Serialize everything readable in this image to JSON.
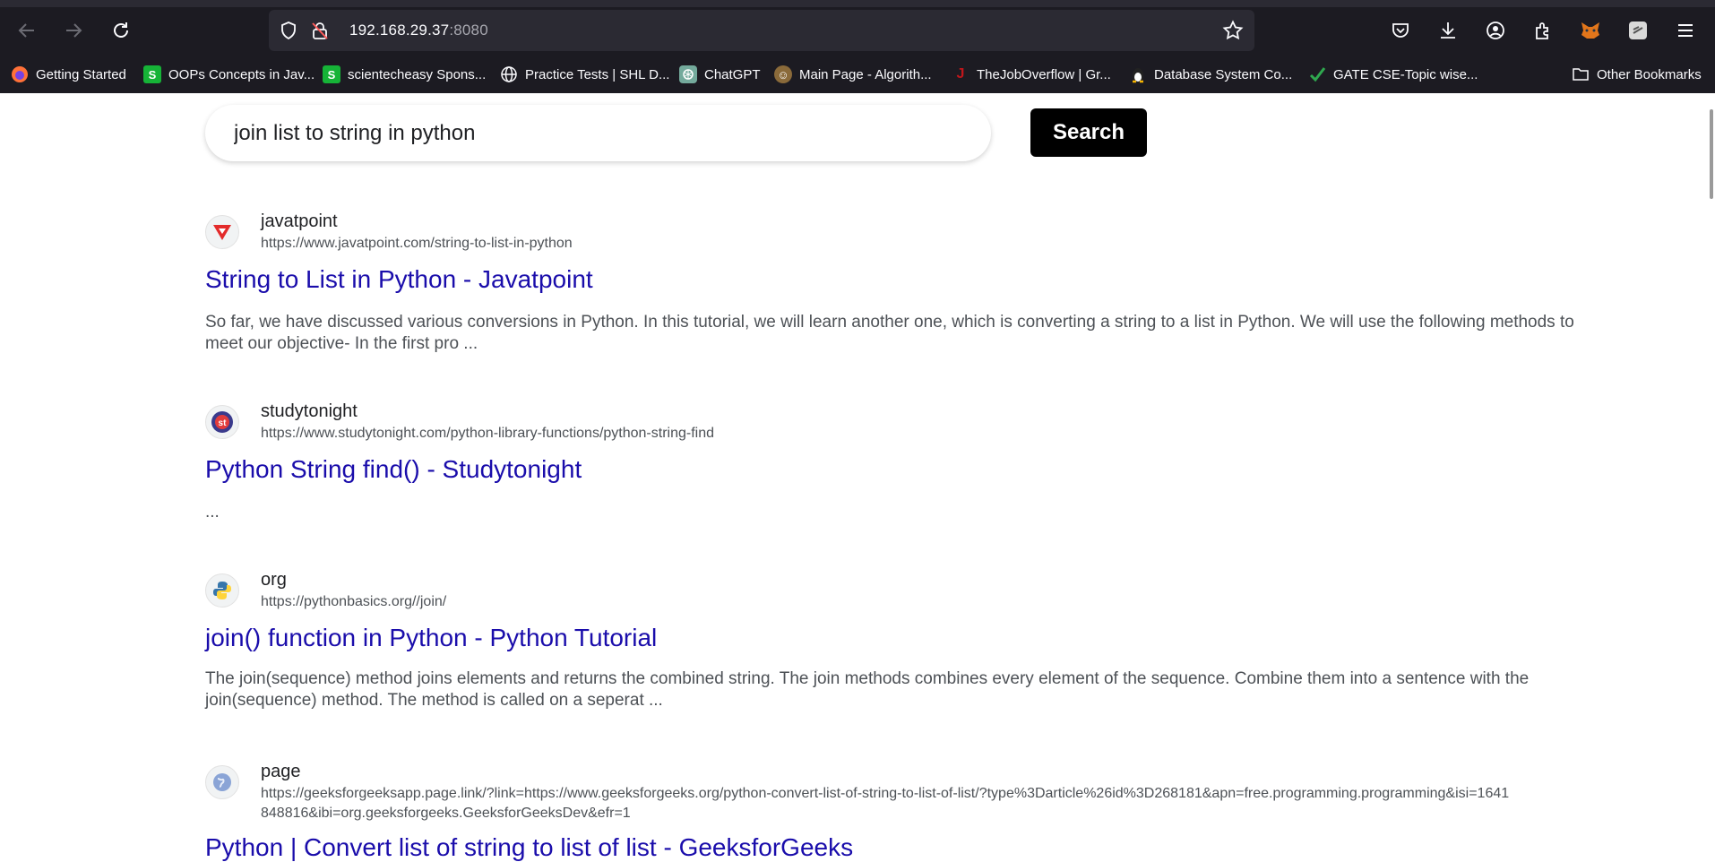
{
  "browser": {
    "url_host": "192.168.29.37",
    "url_port": ":8080",
    "bookmarks": [
      {
        "label": "Getting Started",
        "icon": "firefox-icon"
      },
      {
        "label": "OOPs Concepts in Jav...",
        "icon": "s-green-icon"
      },
      {
        "label": "scientecheasy Spons...",
        "icon": "s-green-icon"
      },
      {
        "label": "Practice Tests | SHL D...",
        "icon": "globe-icon"
      },
      {
        "label": "ChatGPT",
        "icon": "chatgpt-icon"
      },
      {
        "label": "Main Page - Algorith...",
        "icon": "algorithmica-icon"
      },
      {
        "label": "TheJobOverflow | Gr...",
        "icon": "jobs-icon"
      },
      {
        "label": "Database System Co...",
        "icon": "linux-icon"
      },
      {
        "label": "GATE CSE-Topic wise...",
        "icon": "checkmark-icon"
      }
    ],
    "other_bookmarks": "Other Bookmarks",
    "colors": {
      "chrome_bg": "#1c1b22",
      "urlbar_bg": "#2b2a33"
    }
  },
  "search": {
    "query": "join list to string in python",
    "button_label": "Search"
  },
  "results": [
    {
      "site": "javatpoint",
      "url": "https://www.javatpoint.com/string-to-list-in-python",
      "title": "String to List in Python - Javatpoint",
      "snippet": "So far, we have discussed various conversions in Python. In this tutorial, we will learn another one, which is converting a string to a list in Python. We will use the following methods to meet our objective- In the first pro ...",
      "icon": "javatpoint-icon"
    },
    {
      "site": "studytonight",
      "url": "https://www.studytonight.com/python-library-functions/python-string-find",
      "title": "Python String find() - Studytonight",
      "snippet": "...",
      "icon": "studytonight-icon"
    },
    {
      "site": "org",
      "url": "https://pythonbasics.org//join/",
      "title": "join() function in Python - Python Tutorial",
      "snippet": "The join(sequence) method joins elements and returns the combined string. The join methods combines every element of the sequence. Combine them into a sentence with the join(sequence) method. The method is called on a seperat ...",
      "icon": "python-icon"
    },
    {
      "site": "page",
      "url": "https://geeksforgeeksapp.page.link/?link=https://www.geeksforgeeks.org/python-convert-list-of-string-to-list-of-list/?type%3Darticle%26id%3D268181&apn=free.programming.programming&isi=1641848816&ibi=org.geeksforgeeks.GeeksforGeeksDev&efr=1",
      "title": "Python | Convert list of string to list of list - GeeksforGeeks",
      "snippet": "",
      "icon": "globe-icon"
    }
  ],
  "colors": {
    "link": "#1a0dab",
    "snippet": "#4d5156",
    "button_bg": "#000000"
  }
}
